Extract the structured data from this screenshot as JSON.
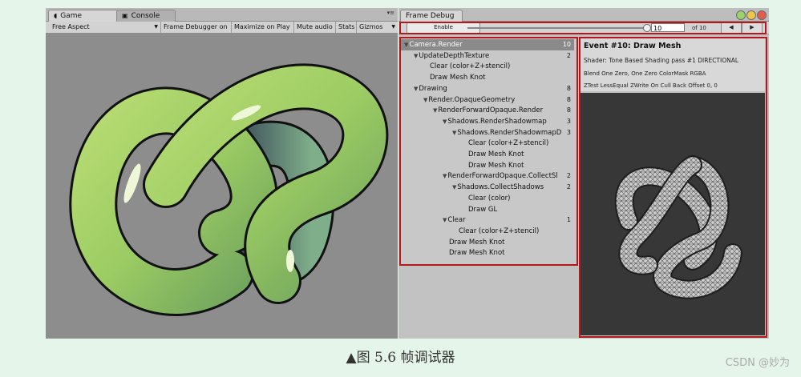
{
  "game_window": {
    "tabs": [
      {
        "label": "Game",
        "icon": "pacman-game-icon",
        "active": true
      },
      {
        "label": "Console",
        "icon": "console-icon",
        "active": false
      }
    ],
    "menu_glyph": "▾≡",
    "toolbar": {
      "aspect": "Free Aspect",
      "frame_debugger_btn": "Frame Debugger on",
      "maximize_btn": "Maximize on Play",
      "mute_btn": "Mute audio",
      "stats_btn": "Stats",
      "gizmos_btn": "Gizmos"
    }
  },
  "frame_debug_window": {
    "title": "Frame Debug",
    "enable_label": "Enable",
    "event_index": "10",
    "of_label": "of 10",
    "prev_icon": "◀",
    "next_icon": "▶",
    "tree": [
      {
        "label": "Camera.Render",
        "count": "10",
        "depth": 0,
        "expanded": true,
        "selected": true
      },
      {
        "label": "UpdateDepthTexture",
        "count": "2",
        "depth": 1,
        "expanded": true
      },
      {
        "label": "Clear (color+Z+stencil)",
        "count": "",
        "depth": 2
      },
      {
        "label": "Draw Mesh Knot",
        "count": "",
        "depth": 2
      },
      {
        "label": "Drawing",
        "count": "8",
        "depth": 1,
        "expanded": true
      },
      {
        "label": "Render.OpaqueGeometry",
        "count": "8",
        "depth": 2,
        "expanded": true
      },
      {
        "label": "RenderForwardOpaque.Render",
        "count": "8",
        "depth": 3,
        "expanded": true
      },
      {
        "label": "Shadows.RenderShadowmap",
        "count": "3",
        "depth": 4,
        "expanded": true
      },
      {
        "label": "Shadows.RenderShadowmapD",
        "count": "3",
        "depth": 5,
        "expanded": true
      },
      {
        "label": "Clear (color+Z+stencil)",
        "count": "",
        "depth": 6
      },
      {
        "label": "Draw Mesh Knot",
        "count": "",
        "depth": 6
      },
      {
        "label": "Draw Mesh Knot",
        "count": "",
        "depth": 6
      },
      {
        "label": "RenderForwardOpaque.CollectSl",
        "count": "2",
        "depth": 4,
        "expanded": true
      },
      {
        "label": "Shadows.CollectShadows",
        "count": "2",
        "depth": 5,
        "expanded": true
      },
      {
        "label": "Clear (color)",
        "count": "",
        "depth": 6
      },
      {
        "label": "Draw GL",
        "count": "",
        "depth": 6
      },
      {
        "label": "Clear",
        "count": "1",
        "depth": 4,
        "expanded": true
      },
      {
        "label": "Clear (color+Z+stencil)",
        "count": "",
        "depth": 5
      },
      {
        "label": "Draw Mesh Knot",
        "count": "",
        "depth": 4
      },
      {
        "label": "Draw Mesh Knot",
        "count": "",
        "depth": 4
      }
    ],
    "details": {
      "event_title": "Event #10: Draw Mesh",
      "shader": "Shader: Tone Based Shading pass #1   DIRECTIONAL",
      "blend": "Blend One Zero, One Zero ColorMask RGBA",
      "ztest": "ZTest LessEqual ZWrite On Cull Back Offset 0, 0"
    }
  },
  "caption": "▲图 5.6    帧调试器",
  "watermark": "CSDN @妙为",
  "colors": {
    "highlight_border": "#b4171d",
    "knot_green": "#a6d26a",
    "page_bg": "#e6f5ea"
  }
}
